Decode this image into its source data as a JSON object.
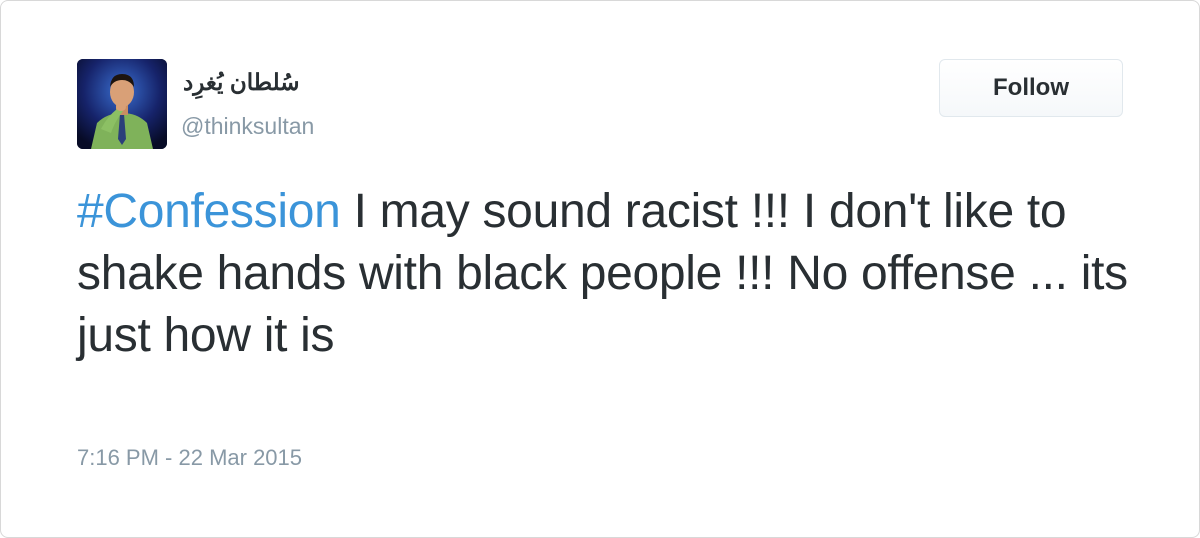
{
  "tweet": {
    "author": {
      "display_name": "سُلطان يُغرِد",
      "handle": "@thinksultan"
    },
    "follow_label": "Follow",
    "hashtag": "#Confession",
    "body": " I may sound racist !!! I don't like to shake hands with black people !!! No offense ... its just how it is",
    "timestamp": "7:16 PM - 22 Mar 2015"
  },
  "colors": {
    "hashtag": "#3b94d9",
    "text": "#292f33",
    "muted": "#8899a6"
  },
  "icons": {
    "avatar": "user-avatar-photo"
  }
}
